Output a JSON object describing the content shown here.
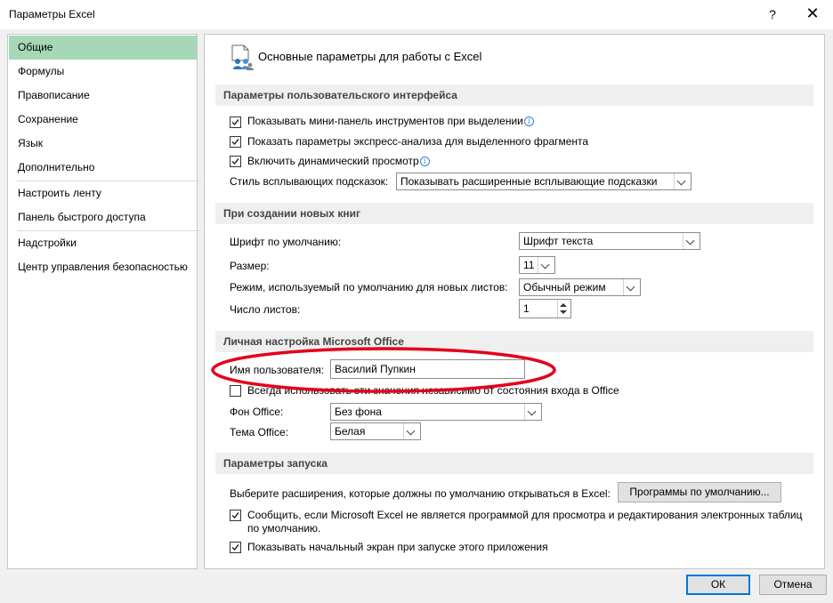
{
  "window": {
    "title": "Параметры Excel",
    "help": "?",
    "close": "✕"
  },
  "nav": {
    "items": [
      {
        "label": "Общие"
      },
      {
        "label": "Формулы"
      },
      {
        "label": "Правописание"
      },
      {
        "label": "Сохранение"
      },
      {
        "label": "Язык"
      },
      {
        "label": "Дополнительно"
      },
      {
        "label": "Настроить ленту"
      },
      {
        "label": "Панель быстрого доступа"
      },
      {
        "label": "Надстройки"
      },
      {
        "label": "Центр управления безопасностью"
      }
    ]
  },
  "page": {
    "title": "Основные параметры для работы с Excel"
  },
  "sections": {
    "ui": {
      "title": "Параметры пользовательского интерфейса",
      "minitoolbar": {
        "label": "Показывать мини-панель инструментов при выделении",
        "checked": true
      },
      "quickanalysis": {
        "label": "Показать параметры экспресс-анализа для выделенного фрагмента",
        "checked": true
      },
      "livepreview": {
        "label": "Включить динамический просмотр",
        "checked": true
      },
      "screentip": {
        "label": "Стиль всплывающих подсказок:",
        "value": "Показывать расширенные всплывающие подсказки"
      }
    },
    "newbooks": {
      "title": "При создании новых книг",
      "font": {
        "label": "Шрифт по умолчанию:",
        "value": "Шрифт текста"
      },
      "size": {
        "label": "Размер:",
        "value": "11"
      },
      "view": {
        "label": "Режим, используемый по умолчанию для новых листов:",
        "value": "Обычный режим"
      },
      "sheets": {
        "label": "Число листов:",
        "value": "1"
      }
    },
    "personal": {
      "title": "Личная настройка Microsoft Office",
      "username": {
        "label": "Имя пользователя:",
        "value": "Василий Пупкин"
      },
      "always": {
        "label": "Всегда использовать эти значения независимо от состояния входа в Office",
        "checked": false
      },
      "background": {
        "label": "Фон Office:",
        "value": "Без фона"
      },
      "theme": {
        "label": "Тема Office:",
        "value": "Белая"
      }
    },
    "startup": {
      "title": "Параметры запуска",
      "extensions": {
        "label": "Выберите расширения, которые должны по умолчанию открываться в Excel:",
        "button": "Программы по умолчанию..."
      },
      "notify": {
        "line1": "Сообщить, если Microsoft Excel не является программой для просмотра и редактирования электронных таблиц",
        "line2": "по умолчанию.",
        "checked": true
      },
      "startscreen": {
        "label": "Показывать начальный экран при запуске этого приложения",
        "checked": true
      }
    }
  },
  "footer": {
    "ok": "ОК",
    "cancel": "Отмена"
  },
  "annotation": {
    "color": "#e3001b"
  }
}
